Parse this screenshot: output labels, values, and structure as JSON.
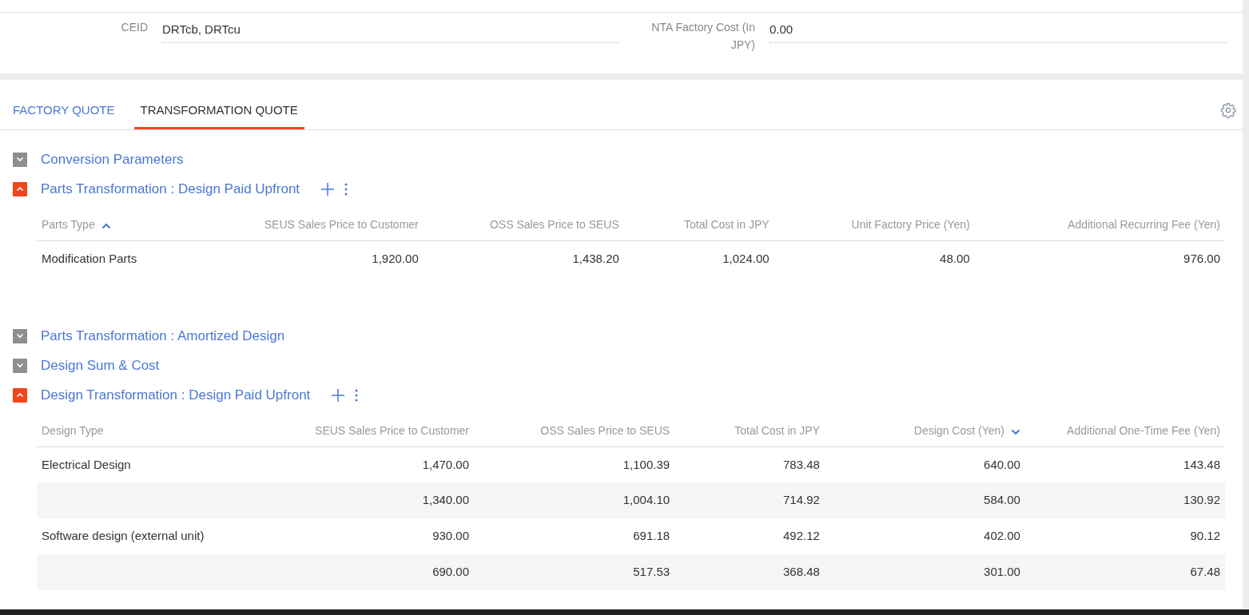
{
  "fields": [
    {
      "label": "CEID",
      "value": "DRTcb, DRTcu"
    },
    {
      "label": "NTA Factory Cost (In JPY)",
      "value": "0.00"
    }
  ],
  "tabs": [
    {
      "label": "FACTORY QUOTE",
      "selected": false
    },
    {
      "label": "TRANSFORMATION QUOTE",
      "selected": true
    }
  ],
  "sections": [
    {
      "title": "Conversion Parameters",
      "expanded": false
    },
    {
      "title": "Parts Transformation : Design Paid Upfront",
      "expanded": true,
      "table": {
        "columns": [
          {
            "label": "Parts Type",
            "sorted": true,
            "descending": false
          },
          {
            "label": "SEUS Sales Price to Customer"
          },
          {
            "label": "OSS Sales Price to SEUS"
          },
          {
            "label": "Total Cost in JPY"
          },
          {
            "label": "Unit Factory Price (Yen)"
          },
          {
            "label": "Additional Recurring Fee (Yen)"
          }
        ],
        "rows": [
          {
            "name": "Modification Parts",
            "values": [
              "1,920.00",
              "1,438.20",
              "1,024.00",
              "48.00",
              "976.00"
            ]
          }
        ]
      }
    },
    {
      "title": "Parts Transformation : Amortized Design",
      "expanded": false
    },
    {
      "title": "Design Sum & Cost",
      "expanded": false
    },
    {
      "title": "Design Transformation : Design Paid Upfront",
      "expanded": true,
      "table": {
        "columns": [
          {
            "label": "Design Type"
          },
          {
            "label": "SEUS Sales Price to Customer"
          },
          {
            "label": "OSS Sales Price to SEUS"
          },
          {
            "label": "Total Cost in JPY"
          },
          {
            "label": "Design Cost (Yen)",
            "sorted": true,
            "descending": true
          },
          {
            "label": "Additional One-Time Fee (Yen)"
          }
        ],
        "rows": [
          {
            "name": "Electrical Design",
            "values": [
              "1,470.00",
              "1,100.39",
              "783.48",
              "640.00",
              "143.48"
            ]
          },
          {
            "values": [
              "1,340.00",
              "1,004.10",
              "714.92",
              "584.00",
              "130.92"
            ]
          },
          {
            "name": "Software design (external unit)",
            "values": [
              "930.00",
              "691.18",
              "492.12",
              "402.00",
              "90.12"
            ]
          },
          {
            "values": [
              "690.00",
              "517.53",
              "368.48",
              "301.00",
              "67.48"
            ]
          }
        ]
      }
    }
  ]
}
